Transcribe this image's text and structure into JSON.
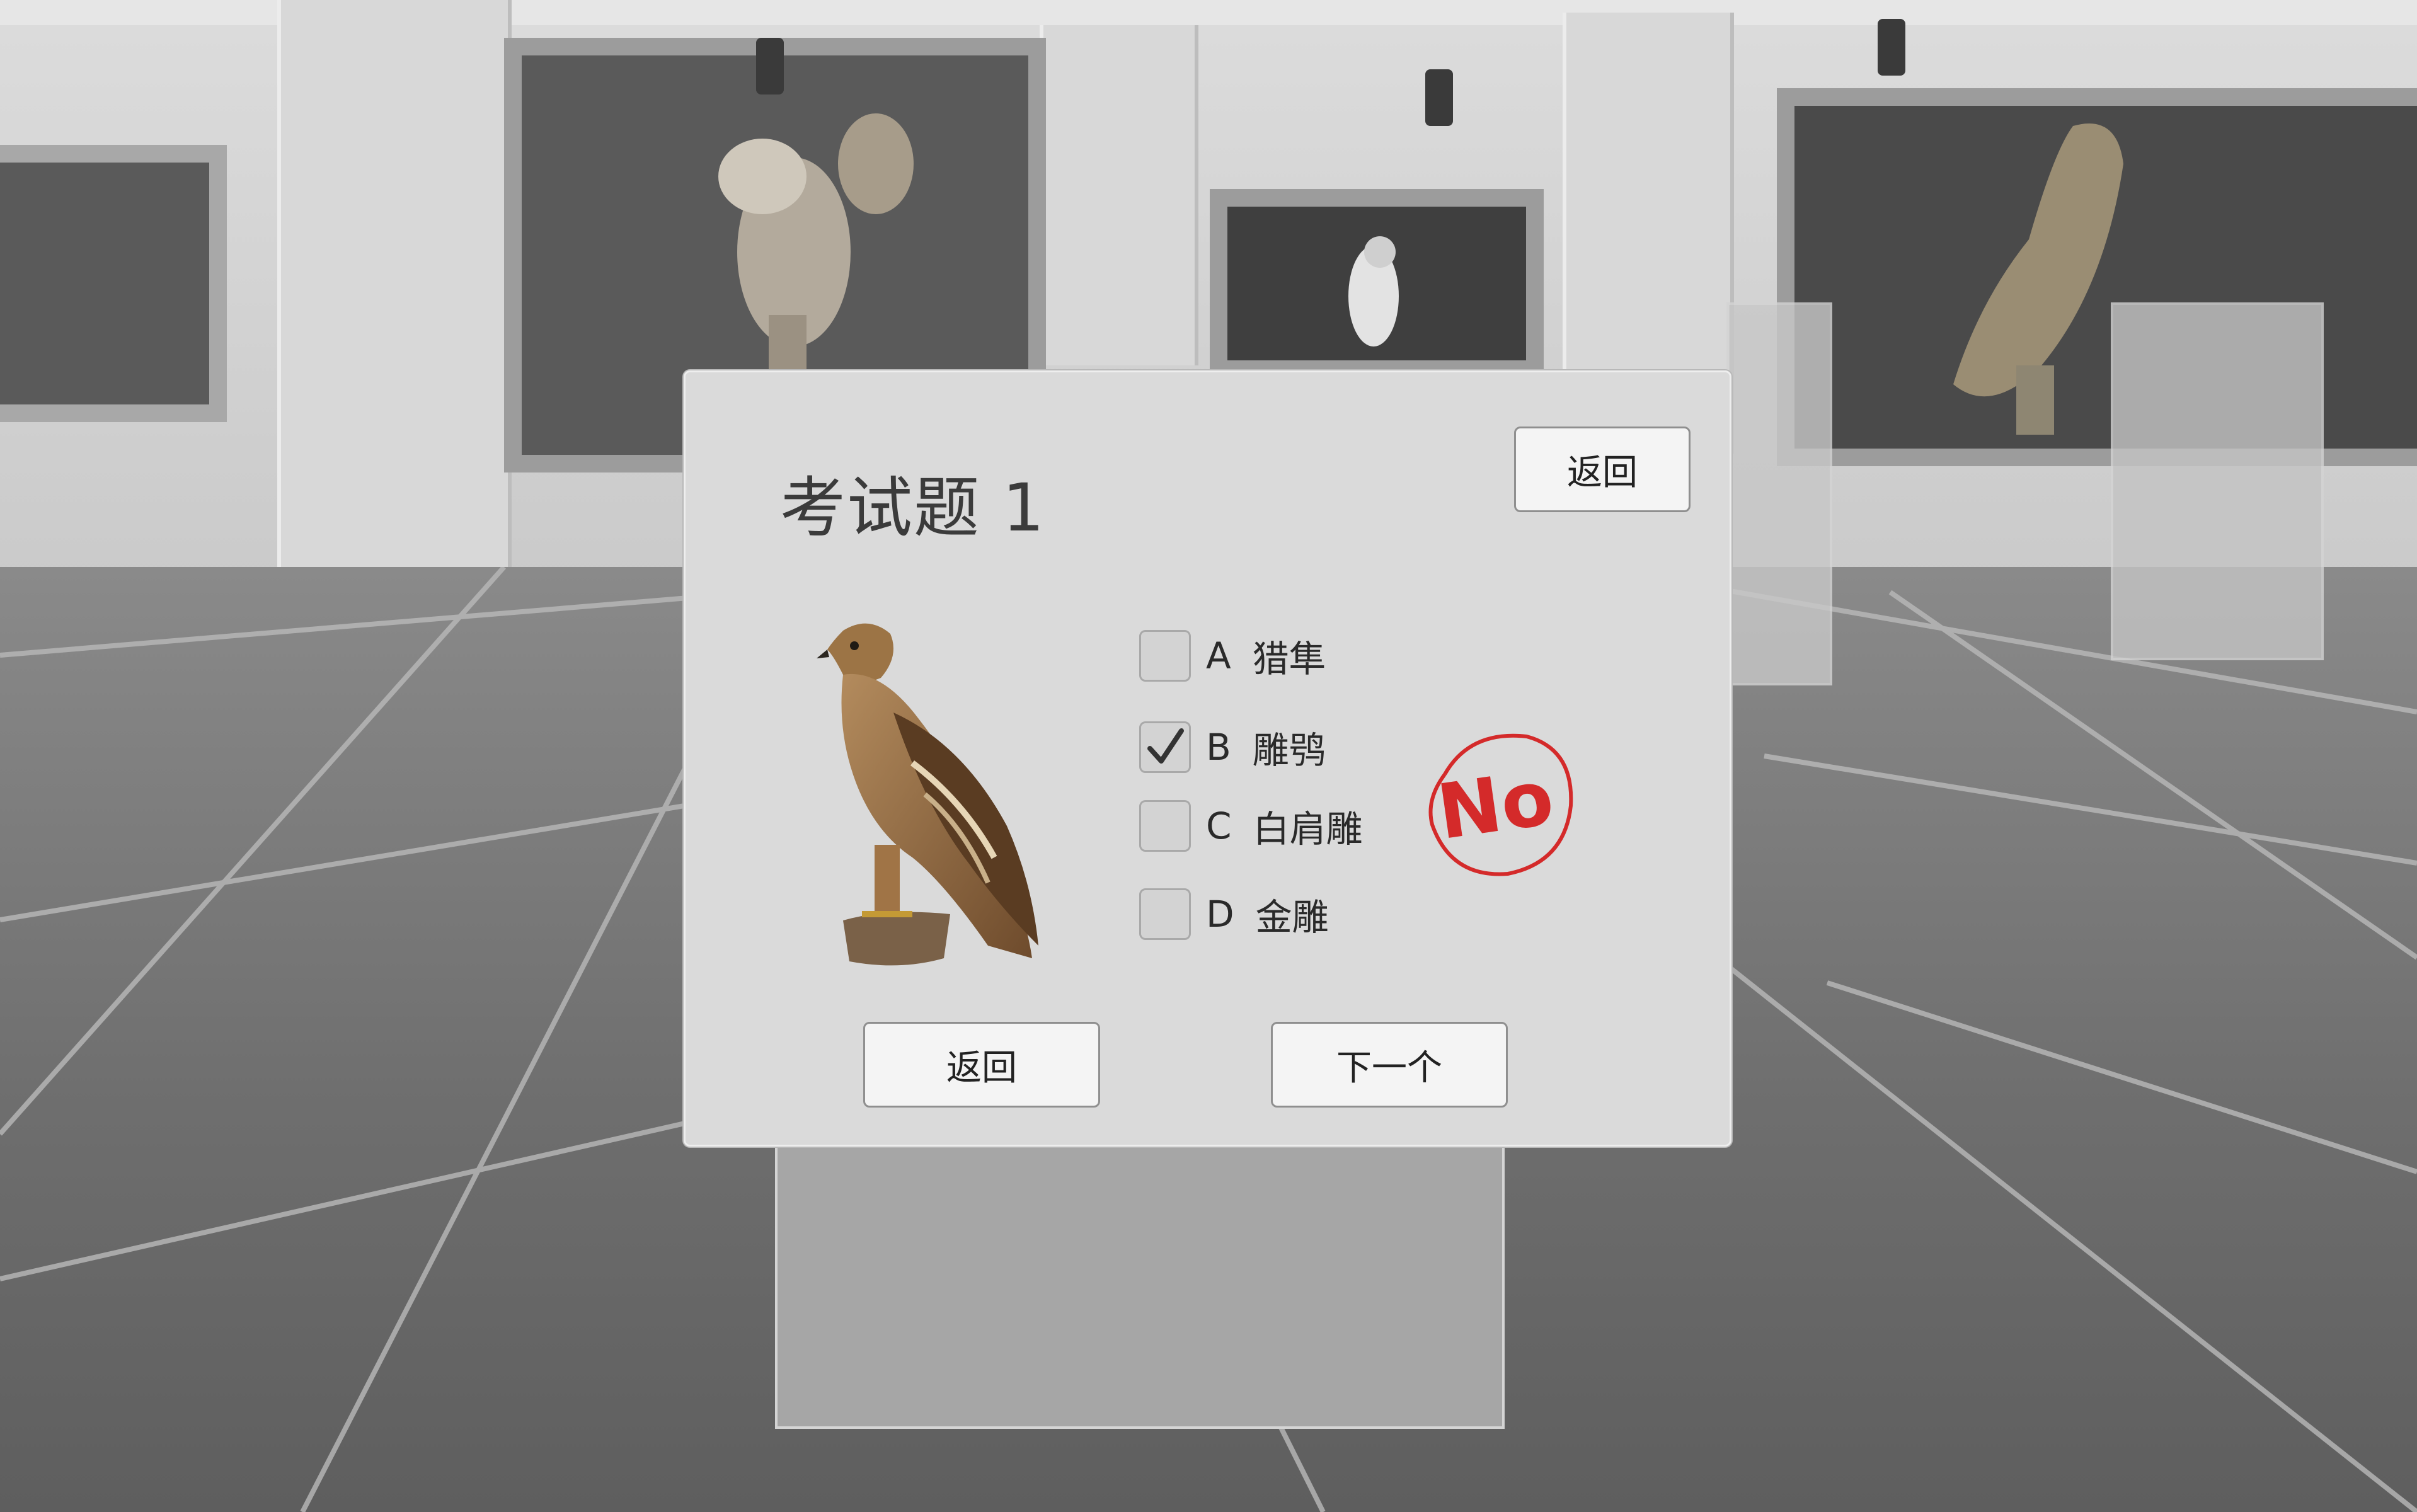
{
  "quiz": {
    "title": "考试题 1",
    "top_return_label": "返回",
    "bottom_return_label": "返回",
    "next_label": "下一个",
    "image_icon": "eagle-photo",
    "options": [
      {
        "letter": "A",
        "text": "猎隼",
        "checked": false
      },
      {
        "letter": "B",
        "text": "雕鸮",
        "checked": true
      },
      {
        "letter": "C",
        "text": "白肩雕",
        "checked": false
      },
      {
        "letter": "D",
        "text": "金雕",
        "checked": false
      }
    ],
    "result_stamp": "No",
    "colors": {
      "stamp": "#d42a2a",
      "dialog_bg": "#dadada",
      "button_bg": "#f4f4f4"
    }
  }
}
